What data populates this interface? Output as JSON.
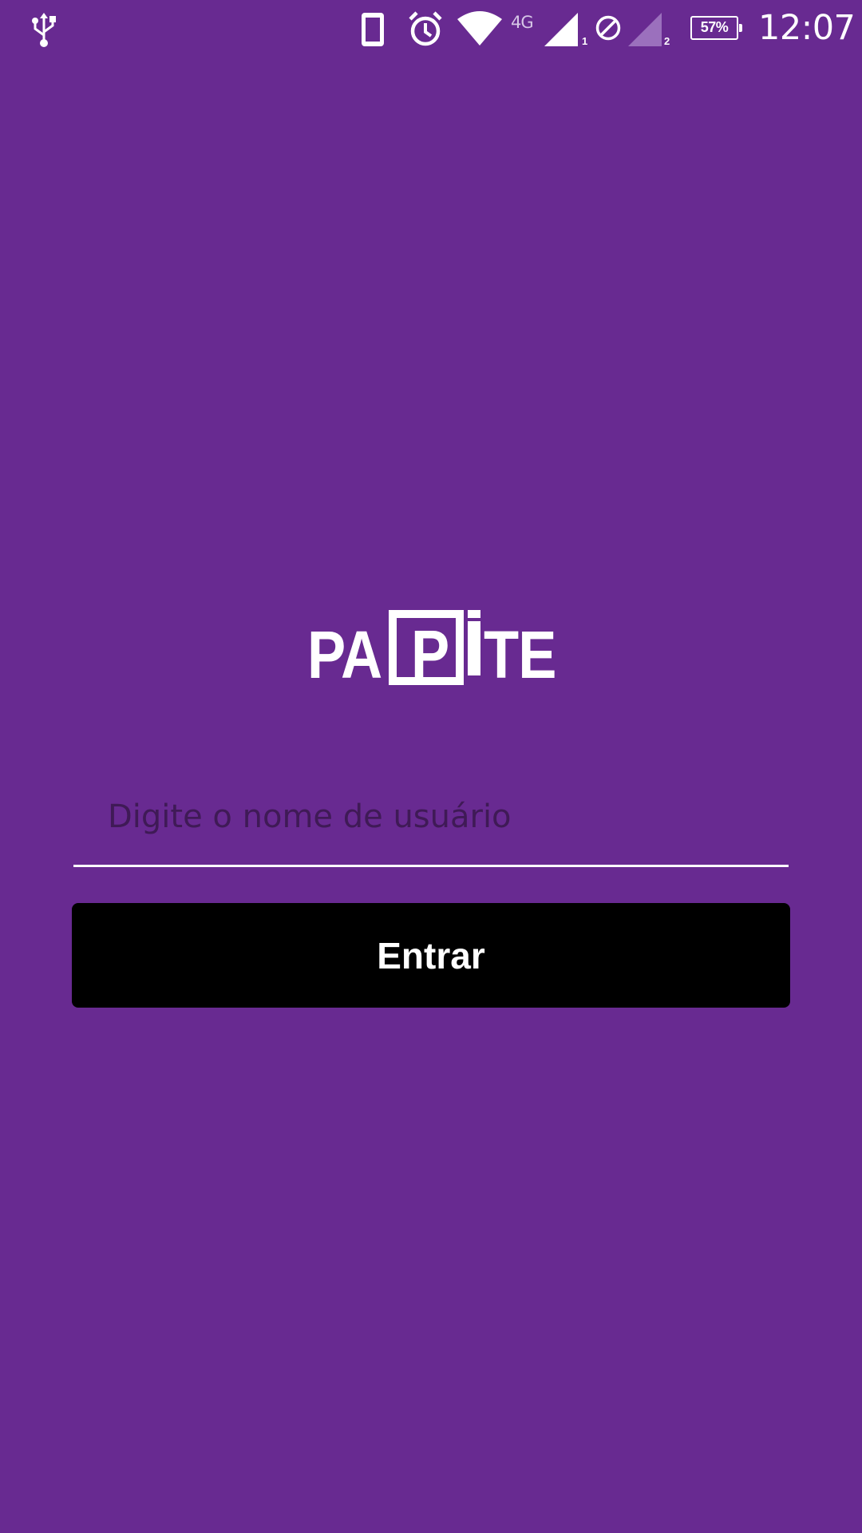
{
  "status_bar": {
    "icons": [
      "usb-icon",
      "phone-icon",
      "alarm-icon",
      "wifi-icon",
      "signal-icon",
      "do-not-disturb-icon",
      "signal-icon"
    ],
    "network_type": "4G",
    "sim1_label": "1",
    "sim2_label": "2",
    "battery_percent": "57%",
    "time": "12:07"
  },
  "logo": {
    "text": "PAPITE"
  },
  "login": {
    "username_placeholder": "Digite o nome de usuário",
    "username_value": "",
    "enter_label": "Entrar"
  },
  "colors": {
    "background": "#682a91",
    "button": "#000000",
    "text": "#ffffff",
    "placeholder": "#3f1a56"
  }
}
